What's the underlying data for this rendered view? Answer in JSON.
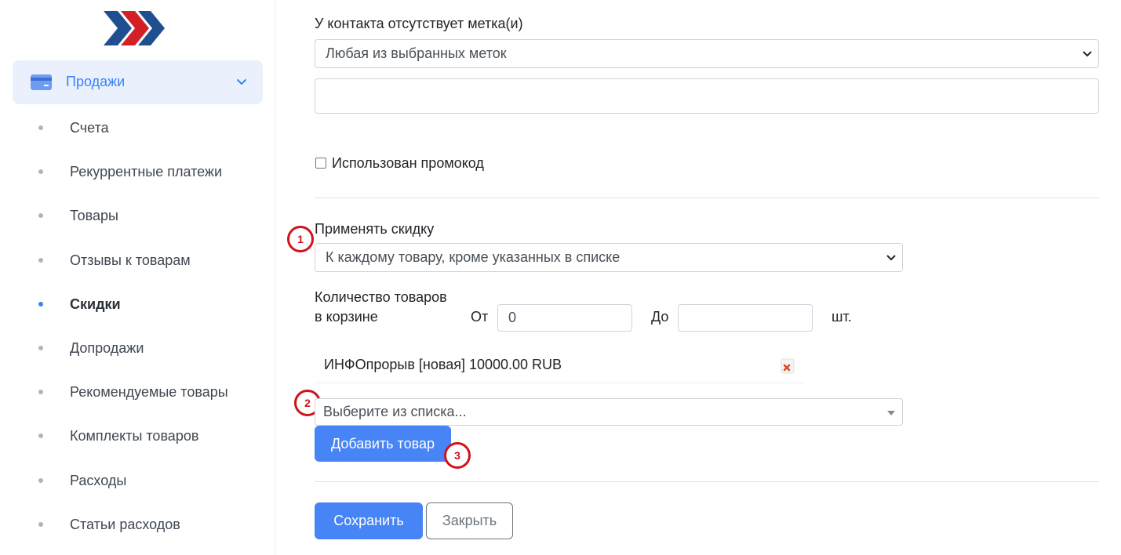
{
  "sidebar": {
    "section": {
      "label": "Продажи",
      "icon": "credit-card-icon"
    },
    "items": [
      {
        "label": "Счета",
        "active": false
      },
      {
        "label": "Рекуррентные платежи",
        "active": false
      },
      {
        "label": "Товары",
        "active": false
      },
      {
        "label": "Отзывы к товарам",
        "active": false
      },
      {
        "label": "Скидки",
        "active": true
      },
      {
        "label": "Допродажи",
        "active": false
      },
      {
        "label": "Рекомендуемые товары",
        "active": false
      },
      {
        "label": "Комплекты товаров",
        "active": false
      },
      {
        "label": "Расходы",
        "active": false
      },
      {
        "label": "Статьи расходов",
        "active": false
      }
    ]
  },
  "form": {
    "missing_tag_label": "У контакта отсутствует метка(и)",
    "missing_tag_select": "Любая из выбранных меток",
    "tags_input_value": "",
    "promo_checkbox_label": "Использован промокод",
    "promo_checked": false,
    "apply_discount_label": "Применять скидку",
    "apply_discount_select": "К каждому товару, кроме указанных в списке",
    "cart_qty_label_line1": "Количество товаров",
    "cart_qty_label_line2": "в корзине",
    "from_label": "От",
    "from_value": "0",
    "to_label": "До",
    "to_value": "",
    "unit_label": "шт.",
    "product_item": "ИНФОпрорыв [новая] 10000.00 RUB",
    "product_select_placeholder": "Выберите из списка...",
    "add_product_button": "Добавить товар",
    "save_button": "Сохранить",
    "close_button": "Закрыть"
  },
  "annotations": [
    "1",
    "2",
    "3"
  ],
  "colors": {
    "accent": "#4784f5",
    "sidebar_active_bg": "#eaf1fd",
    "annotation_red": "#d0121b"
  }
}
